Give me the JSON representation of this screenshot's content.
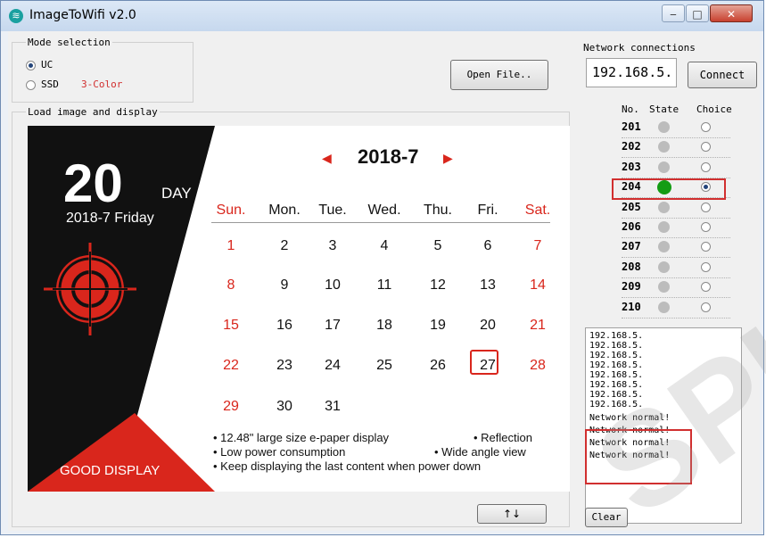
{
  "window": {
    "title": "ImageToWifi v2.0"
  },
  "mode": {
    "label": "Mode selection",
    "options": [
      {
        "label": "UC",
        "selected": true
      },
      {
        "label": "SSD",
        "selected": false
      }
    ],
    "ssd_note": "3-Color"
  },
  "open_file_label": "Open File..",
  "display_group_label": "Load image and display",
  "calendar": {
    "day_number": "20",
    "day_word": "DAY",
    "date_line": "2018-7 Friday",
    "month_title": "2018-7",
    "prev_arrow": "◀",
    "next_arrow": "▶",
    "weekdays": [
      "Sun.",
      "Mon.",
      "Tue.",
      "Wed.",
      "Thu.",
      "Fri.",
      "Sat."
    ],
    "weeks": [
      [
        "1",
        "2",
        "3",
        "4",
        "5",
        "6",
        "7"
      ],
      [
        "8",
        "9",
        "10",
        "11",
        "12",
        "13",
        "14"
      ],
      [
        "15",
        "16",
        "17",
        "18",
        "19",
        "20",
        "21"
      ],
      [
        "22",
        "23",
        "24",
        "25",
        "26",
        "27",
        "28"
      ],
      [
        "29",
        "30",
        "31",
        "",
        "",
        "",
        ""
      ]
    ],
    "today": "20",
    "brand_part1": "GOOD ",
    "brand_part2": "DISPLAY",
    "features": [
      [
        "• 12.48\" large size e-paper display",
        "• Reflection"
      ],
      [
        "• Low power consumption",
        "• Wide angle view"
      ],
      [
        "• Keep displaying the last content when power down",
        ""
      ]
    ],
    "colors": {
      "red": "#d9261c",
      "black": "#111111"
    }
  },
  "rotate_button_label": "↑↓",
  "network": {
    "label": "Network connections",
    "ip_value": "192.168.5.",
    "connect_label": "Connect",
    "col_no": "No.",
    "col_state": "State",
    "col_choice": "Choice",
    "devices": [
      {
        "no": "201",
        "connected": false,
        "chosen": false
      },
      {
        "no": "202",
        "connected": false,
        "chosen": false
      },
      {
        "no": "203",
        "connected": false,
        "chosen": false
      },
      {
        "no": "204",
        "connected": true,
        "chosen": true
      },
      {
        "no": "205",
        "connected": false,
        "chosen": false
      },
      {
        "no": "206",
        "connected": false,
        "chosen": false
      },
      {
        "no": "207",
        "connected": false,
        "chosen": false
      },
      {
        "no": "208",
        "connected": false,
        "chosen": false
      },
      {
        "no": "209",
        "connected": false,
        "chosen": false
      },
      {
        "no": "210",
        "connected": false,
        "chosen": false
      }
    ],
    "log": [
      "192.168.5.",
      "192.168.5.",
      "192.168.5.",
      "192.168.5.",
      "192.168.5.",
      "192.168.5.",
      "192.168.5.",
      "192.168.5.",
      "Network normal!",
      "Network normal!",
      "Network normal!",
      "Network normal!"
    ],
    "clear_label": "Clear"
  },
  "watermark": "SPL"
}
